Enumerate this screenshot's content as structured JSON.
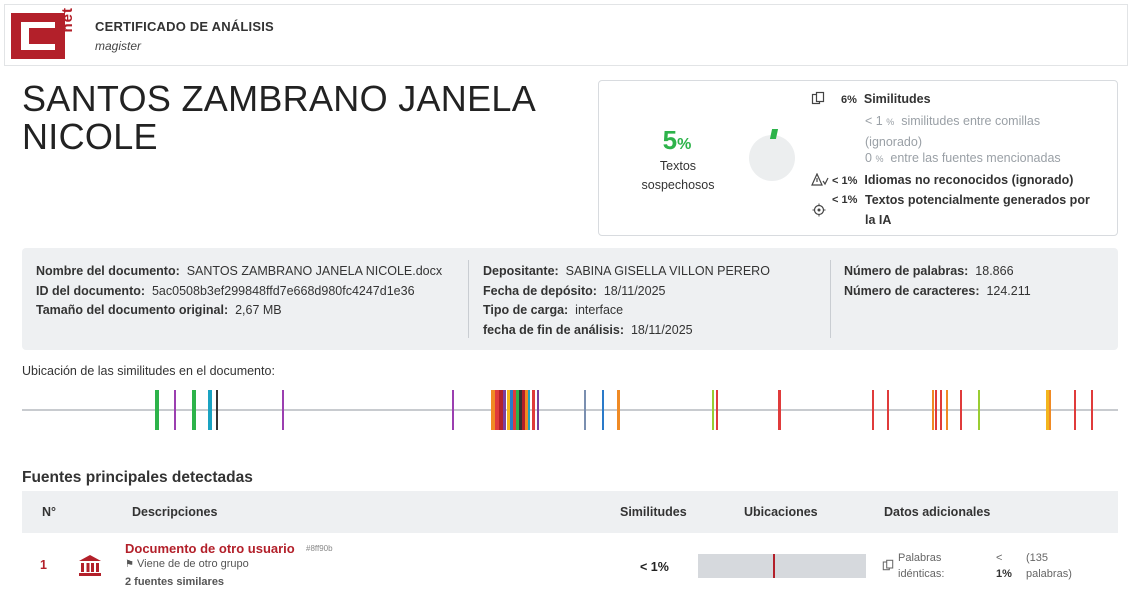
{
  "header": {
    "title": "CERTIFICADO DE ANÁLISIS",
    "subtitle": "magister",
    "logo_text": "net"
  },
  "person_name": "SANTOS ZAMBRANO JANELA NICOLE",
  "summary": {
    "percent_value": "5",
    "percent_sign": "%",
    "percent_label": "Textos sospechosos",
    "similitudes_pct": "6",
    "similitudes_label": "Similitudes",
    "comillas_pct": "< 1",
    "comillas_label": "similitudes entre comillas (ignorado)",
    "mencionadas_pct": "0",
    "mencionadas_label": "entre las fuentes mencionadas",
    "idiomas_pct": "< 1",
    "idiomas_label": "Idiomas no reconocidos (ignorado)",
    "ia_pct": "< 1",
    "ia_label": "Textos potencialmente generados por la IA",
    "unit": "%",
    "accent_color": "#2db34a",
    "brand_color": "#b3202a"
  },
  "info": {
    "doc_name_label": "Nombre del documento:",
    "doc_name": "SANTOS ZAMBRANO JANELA NICOLE.docx",
    "doc_id_label": "ID del documento:",
    "doc_id": "5ac0508b3ef299848ffd7e668d980fc4247d1e36",
    "size_label": "Tamaño del documento original:",
    "size": "2,67 MB",
    "depositor_label": "Depositante:",
    "depositor": "SABINA GISELLA VILLON PERERO",
    "deposit_date_label": "Fecha de depósito:",
    "deposit_date": "18/11/2025",
    "upload_type_label": "Tipo de carga:",
    "upload_type": "interface",
    "end_date_label": "fecha de fin de análisis:",
    "end_date": "18/11/2025",
    "words_label": "Número de palabras:",
    "words": "18.866",
    "chars_label": "Número de caracteres:",
    "chars": "124.211"
  },
  "location": {
    "label": "Ubicación de las similitudes en el documento:"
  },
  "sources": {
    "title": "Fuentes principales detectadas",
    "columns": {
      "num": "N°",
      "desc": "Descripciones",
      "sim": "Similitudes",
      "loc": "Ubicaciones",
      "extra": "Datos adicionales"
    },
    "rows": [
      {
        "num": "1",
        "name": "Documento de otro usuario",
        "hash": "#8ff90b",
        "group": "Viene de de otro grupo",
        "similar": "2 fuentes similares",
        "similarity": "< 1%",
        "extra_label_1": "Palabras",
        "extra_label_2": "idénticas:",
        "extra_val_1": "<",
        "extra_val_2": "1%",
        "extra_count_1": "(135",
        "extra_count_2": "palabras)"
      }
    ]
  }
}
